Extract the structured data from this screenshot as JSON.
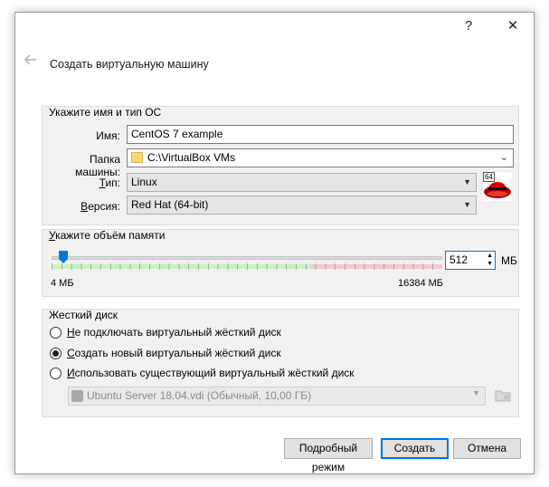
{
  "titlebar": {
    "help_label": "?",
    "close_label": "✕"
  },
  "wizard": {
    "back_icon": "arrow-left-icon",
    "title": "Создать виртуальную машину"
  },
  "name_os": {
    "group_title": "Укажите имя и тип ОС",
    "name_label": "Имя:",
    "name_value": "CentOS 7 example",
    "folder_label": "Папка машины:",
    "folder_value": "C:\\VirtualBox VMs",
    "type_label_prefix": "Т",
    "type_label_rest": "ип:",
    "type_value": "Linux",
    "version_label_prefix": "В",
    "version_label_rest": "ерсия:",
    "version_value": "Red Hat (64-bit)",
    "os_badge": "64"
  },
  "memory": {
    "group_title_prefix": "У",
    "group_title_rest": "кажите объём памяти",
    "value": "512",
    "unit": "МБ",
    "min_label": "4 МБ",
    "max_label": "16384 МБ",
    "slider_fraction": 0.031
  },
  "disk": {
    "group_title": "Жесткий диск",
    "options": [
      {
        "prefix": "Н",
        "rest": "е подключать виртуальный жёсткий диск",
        "selected": false
      },
      {
        "prefix": "С",
        "rest": "оздать новый виртуальный жёсткий диск",
        "selected": true
      },
      {
        "prefix": "И",
        "rest": "спользовать существующий виртуальный жёсткий диск",
        "selected": false
      }
    ],
    "existing_disk": "Ubuntu Server 18.04.vdi (Обычный, 10,00 ГБ)"
  },
  "buttons": {
    "expert": "Подробный режим",
    "create": "Создать",
    "cancel": "Отмена"
  },
  "colors": {
    "accent": "#0078d7",
    "slider_green": "#c8f0c0",
    "slider_red": "#f5c7c7"
  }
}
